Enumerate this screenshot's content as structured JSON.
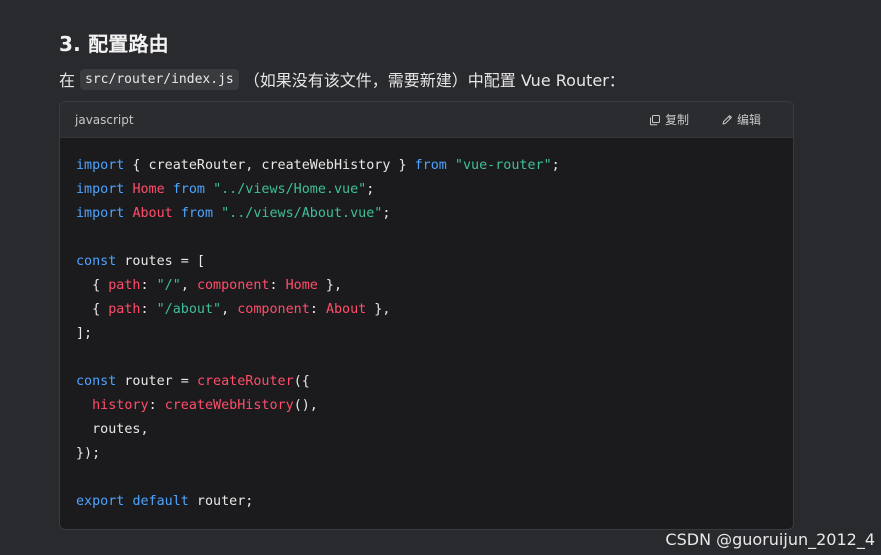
{
  "heading": "3. 配置路由",
  "intro": {
    "prefix": "在",
    "path": "src/router/index.js",
    "suffix": "（如果没有该文件，需要新建）中配置 Vue Router："
  },
  "code_block": {
    "language": "javascript",
    "copy_label": "复制",
    "edit_label": "编辑",
    "copy_icon": "copy-icon",
    "edit_icon": "edit-pencil-icon",
    "lines": [
      [
        {
          "t": "kw",
          "v": "import"
        },
        {
          "t": "pl",
          "v": " { createRouter, createWebHistory } "
        },
        {
          "t": "kw",
          "v": "from"
        },
        {
          "t": "pl",
          "v": " "
        },
        {
          "t": "str",
          "v": "\"vue-router\""
        },
        {
          "t": "pl",
          "v": ";"
        }
      ],
      [
        {
          "t": "kw",
          "v": "import"
        },
        {
          "t": "pl",
          "v": " "
        },
        {
          "t": "id",
          "v": "Home"
        },
        {
          "t": "pl",
          "v": " "
        },
        {
          "t": "kw",
          "v": "from"
        },
        {
          "t": "pl",
          "v": " "
        },
        {
          "t": "str",
          "v": "\"../views/Home.vue\""
        },
        {
          "t": "pl",
          "v": ";"
        }
      ],
      [
        {
          "t": "kw",
          "v": "import"
        },
        {
          "t": "pl",
          "v": " "
        },
        {
          "t": "id",
          "v": "About"
        },
        {
          "t": "pl",
          "v": " "
        },
        {
          "t": "kw",
          "v": "from"
        },
        {
          "t": "pl",
          "v": " "
        },
        {
          "t": "str",
          "v": "\"../views/About.vue\""
        },
        {
          "t": "pl",
          "v": ";"
        }
      ],
      [],
      [
        {
          "t": "kw",
          "v": "const"
        },
        {
          "t": "pl",
          "v": " routes = ["
        }
      ],
      [
        {
          "t": "pl",
          "v": "  { "
        },
        {
          "t": "id",
          "v": "path"
        },
        {
          "t": "pl",
          "v": ": "
        },
        {
          "t": "str",
          "v": "\"/\""
        },
        {
          "t": "pl",
          "v": ", "
        },
        {
          "t": "id",
          "v": "component"
        },
        {
          "t": "pl",
          "v": ": "
        },
        {
          "t": "id",
          "v": "Home"
        },
        {
          "t": "pl",
          "v": " },"
        }
      ],
      [
        {
          "t": "pl",
          "v": "  { "
        },
        {
          "t": "id",
          "v": "path"
        },
        {
          "t": "pl",
          "v": ": "
        },
        {
          "t": "str",
          "v": "\"/about\""
        },
        {
          "t": "pl",
          "v": ", "
        },
        {
          "t": "id",
          "v": "component"
        },
        {
          "t": "pl",
          "v": ": "
        },
        {
          "t": "id",
          "v": "About"
        },
        {
          "t": "pl",
          "v": " },"
        }
      ],
      [
        {
          "t": "pl",
          "v": "];"
        }
      ],
      [],
      [
        {
          "t": "kw",
          "v": "const"
        },
        {
          "t": "pl",
          "v": " router = "
        },
        {
          "t": "id",
          "v": "createRouter"
        },
        {
          "t": "pl",
          "v": "({"
        }
      ],
      [
        {
          "t": "pl",
          "v": "  "
        },
        {
          "t": "id",
          "v": "history"
        },
        {
          "t": "pl",
          "v": ": "
        },
        {
          "t": "id",
          "v": "createWebHistory"
        },
        {
          "t": "pl",
          "v": "(),"
        }
      ],
      [
        {
          "t": "pl",
          "v": "  routes,"
        }
      ],
      [
        {
          "t": "pl",
          "v": "});"
        }
      ],
      [],
      [
        {
          "t": "kw",
          "v": "export"
        },
        {
          "t": "pl",
          "v": " "
        },
        {
          "t": "kw",
          "v": "default"
        },
        {
          "t": "pl",
          "v": " router;"
        }
      ]
    ]
  },
  "watermark": "CSDN @guoruijun_2012_4",
  "colors": {
    "keyword": "#4da3ff",
    "identifier": "#ff4d6a",
    "string": "#3dbf9a",
    "plain": "#e8e8e8",
    "background": "#292a2d",
    "code_background": "#1b1b1d"
  }
}
